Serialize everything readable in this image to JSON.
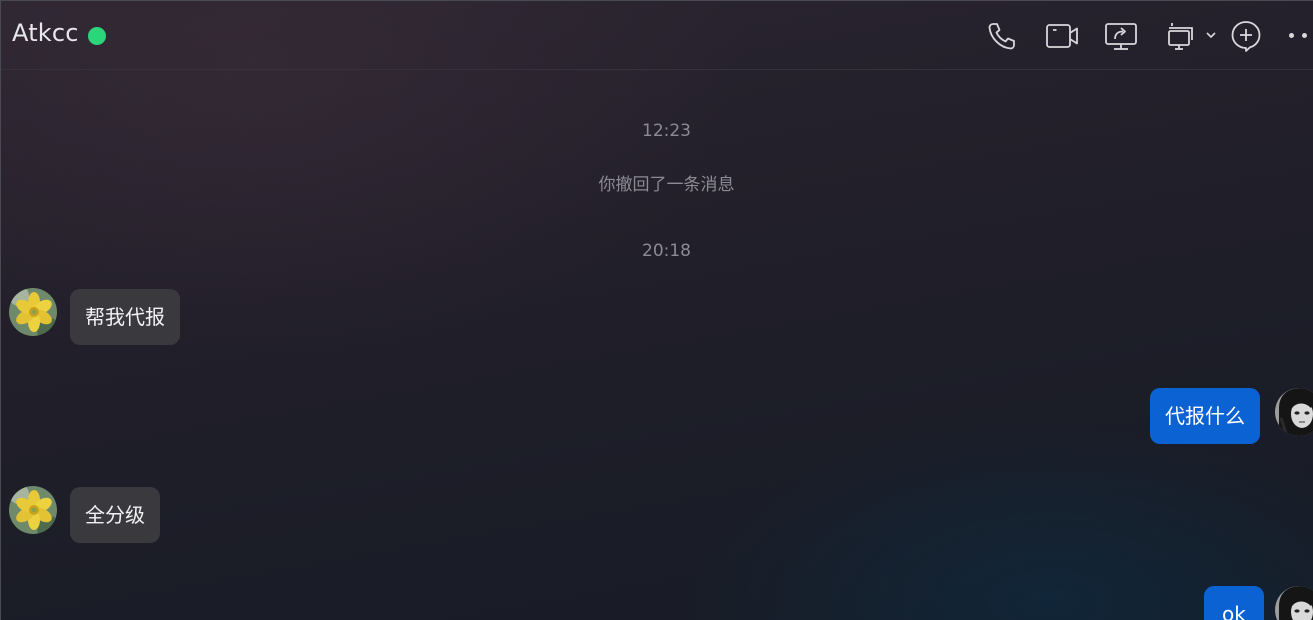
{
  "header": {
    "title": "Atkcc",
    "status_color": "#2bd67b",
    "buttons": [
      "phone-icon",
      "video-call-icon",
      "screen-share-icon",
      "screenshot-icon",
      "add-member-icon",
      "more-icon"
    ]
  },
  "messages": {
    "time1": "12:23",
    "system1": "你撤回了一条消息",
    "time2": "20:18",
    "msg1": "帮我代报",
    "msg2": "代报什么",
    "msg3": "全分级",
    "msg4": "ok"
  },
  "colors": {
    "incoming_bubble": "#3a3a3e",
    "outgoing_bubble": "#0b63d3",
    "muted_text": "#8b8b93"
  }
}
